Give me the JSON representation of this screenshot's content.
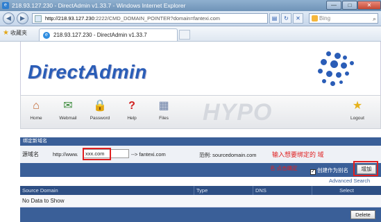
{
  "window": {
    "title": "218.93.127.230 - DirectAdmin v1.33.7 - Windows Internet Explorer",
    "minimize": "—",
    "maximize": "□",
    "close": "✕"
  },
  "address_bar": {
    "url_host": "http://218.93.127.230",
    "url_rest": ":2222/CMD_DOMAIN_POINTER?domain=fantexi.com",
    "search_placeholder": "Bing"
  },
  "favorites_bar": {
    "favorites_label": "收藏夹",
    "tab_title": "218.93.127.230 - DirectAdmin v1.33.7"
  },
  "brand": {
    "logo": "DirectAdmin",
    "skin_watermark": "HYPO"
  },
  "nav": {
    "home": "Home",
    "webmail": "Webmail",
    "password": "Password",
    "help": "Help",
    "files": "Files",
    "logout": "Logout"
  },
  "form": {
    "section_title": "绑定新域名",
    "domain_label": "源域名",
    "http_prefix": "http://www.",
    "domain_value": "xxx.com",
    "suffix": "--> fantexi.com",
    "example": "范例: sourcedomain.com",
    "annotation_input": "输入想要绑定的 域",
    "annotation_alias": "名 点击确定",
    "alias_label": "创建作为别名",
    "add_button": "增加"
  },
  "table": {
    "advanced_search": "Advanced Search",
    "columns": [
      "Source Domain",
      "Type",
      "DNS",
      "Select"
    ],
    "empty_message": "No Data to Show",
    "delete_button": "Delete"
  },
  "colors": {
    "brand_blue": "#2a5db7",
    "section_blue": "#3a5f98",
    "annotation_red": "#e02020"
  }
}
